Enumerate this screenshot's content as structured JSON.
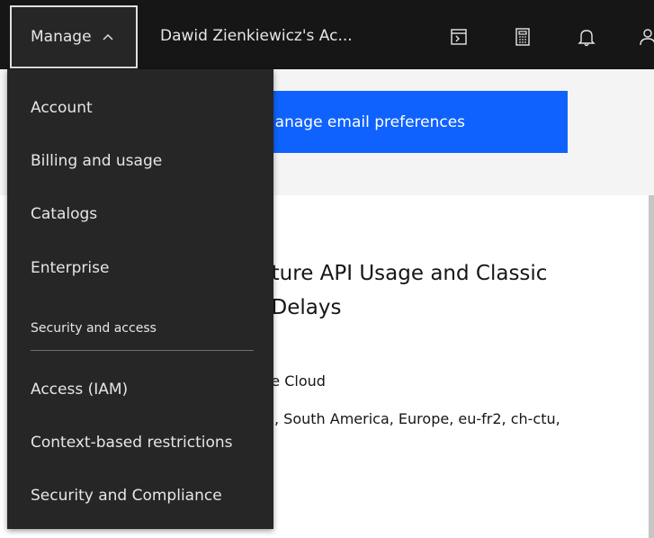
{
  "header": {
    "manage_label": "Manage",
    "account_name": "Dawid Zienkiewicz's Ac...",
    "icons": [
      "terminal-icon",
      "calculator-icon",
      "notification-icon",
      "user-icon"
    ]
  },
  "menu": {
    "items": [
      {
        "label": "Account"
      },
      {
        "label": "Billing and usage"
      },
      {
        "label": "Catalogs"
      },
      {
        "label": "Enterprise"
      }
    ],
    "section_heading": "Security and access",
    "security_items": [
      {
        "label": "Access (IAM)"
      },
      {
        "label": "Context-based restrictions"
      },
      {
        "label": "Security and Compliance"
      }
    ]
  },
  "content": {
    "email_button": "Manage email preferences",
    "card_title": "cture API Usage and Classic ng Delays",
    "card_title_line1": "cture API Usage and Classic",
    "card_title_line2": "ng Delays",
    "line1": "te Cloud",
    "line2": ", South America, Europe, eu-fr2, ch-ctu,"
  }
}
